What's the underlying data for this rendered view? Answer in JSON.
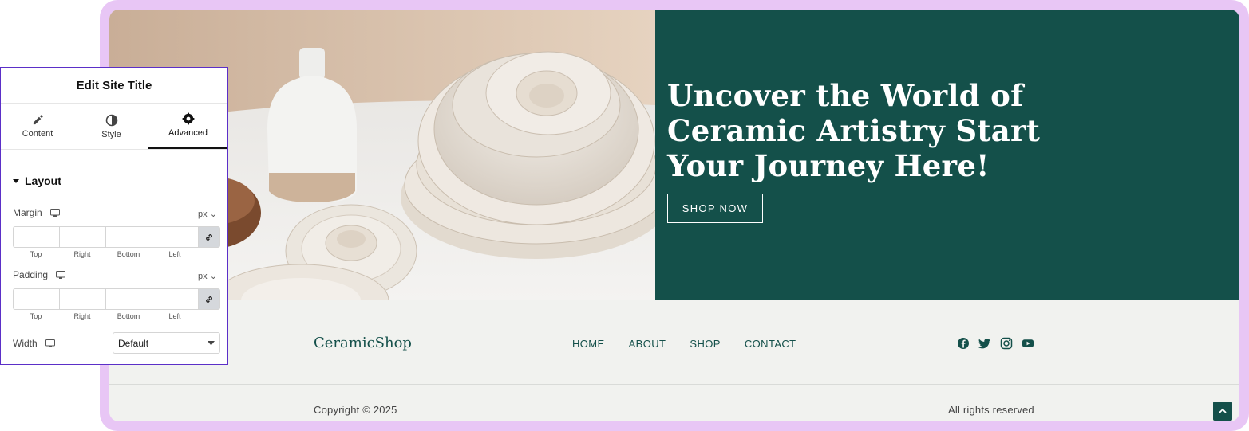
{
  "hero": {
    "title": "Uncover the World of Ceramic Artistry Start Your Journey Here!",
    "button_label": "SHOP NOW"
  },
  "footer": {
    "brand": "CeramicShop",
    "nav": [
      "HOME",
      "ABOUT",
      "SHOP",
      "CONTACT"
    ],
    "social_icons": [
      "facebook-icon",
      "twitter-icon",
      "instagram-icon",
      "youtube-icon"
    ],
    "copyright": "Copyright © 2025",
    "rights": "All rights reserved"
  },
  "panel": {
    "title": "Edit Site Title",
    "tabs": [
      {
        "label": "Content",
        "icon": "pencil-icon"
      },
      {
        "label": "Style",
        "icon": "contrast-icon"
      },
      {
        "label": "Advanced",
        "icon": "gear-icon",
        "active": true
      }
    ],
    "section_title": "Layout",
    "margin": {
      "label": "Margin",
      "unit": "px",
      "values": [
        "",
        "",
        "",
        ""
      ]
    },
    "padding": {
      "label": "Padding",
      "unit": "px",
      "values": [
        "",
        "",
        "",
        ""
      ]
    },
    "dim_labels": [
      "Top",
      "Right",
      "Bottom",
      "Left"
    ],
    "width": {
      "label": "Width",
      "value": "Default"
    }
  },
  "colors": {
    "frame": "#e8c6f5",
    "hero_bg": "#14504a",
    "footer_bg": "#f1f2ef",
    "panel_border": "#5b2fc8"
  }
}
